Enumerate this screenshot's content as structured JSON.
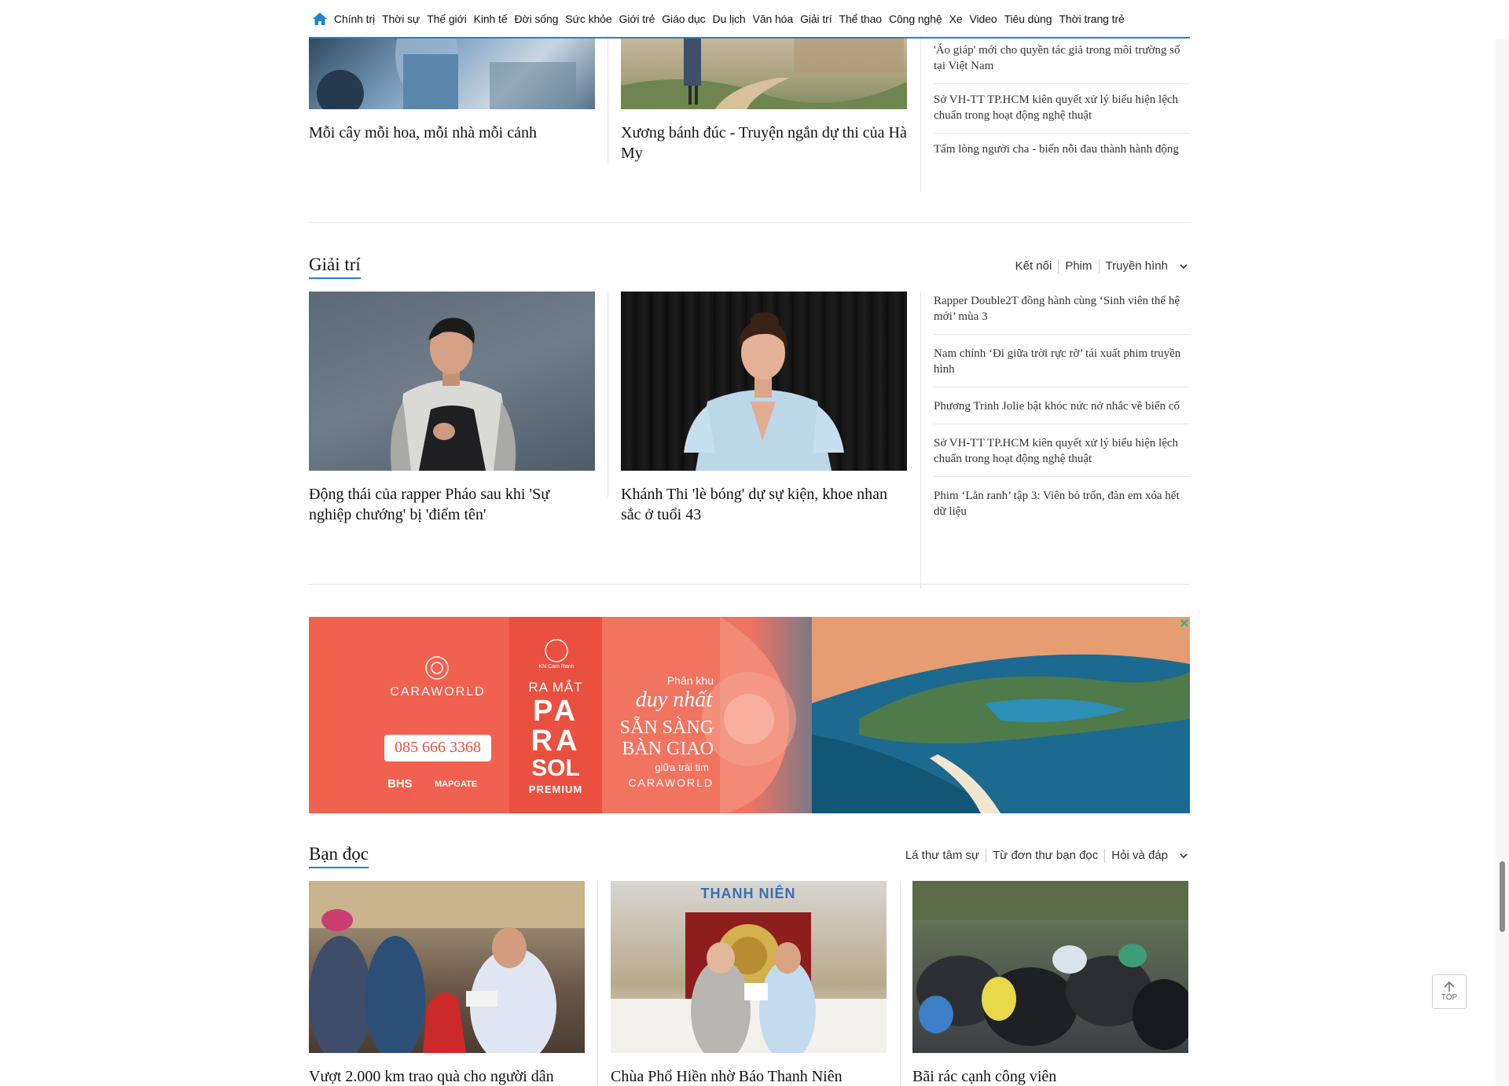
{
  "nav": {
    "items": [
      "Chính trị",
      "Thời sự",
      "Thế giới",
      "Kinh tế",
      "Đời sống",
      "Sức khỏe",
      "Giới trẻ",
      "Giáo dục",
      "Du lịch",
      "Văn hóa",
      "Giải trí",
      "Thể thao",
      "Công nghệ",
      "Xe",
      "Video",
      "Tiêu dùng",
      "Thời trang trẻ"
    ],
    "accent": "#1d86c9"
  },
  "section_vanhoa": {
    "cards": [
      {
        "title": "Mỗi cây mỗi hoa, mỗi nhà mỗi cảnh"
      },
      {
        "title": "Xương bánh đúc - Truyện ngắn dự thi của Hà My"
      }
    ],
    "side": [
      "'Áo giáp' mới cho quyền tác giả trong môi trường số tại Việt Nam",
      "Sở VH-TT TP.HCM kiên quyết xử lý biểu hiện lệch chuẩn trong hoạt động nghệ thuật",
      "Tấm lòng người cha - biến nỗi đau thành hành động"
    ]
  },
  "section_giaitri": {
    "title": "Giải trí",
    "tabs": [
      "Kết nối",
      "Phim",
      "Truyền hình"
    ],
    "cards": [
      {
        "title": "Động thái của rapper Pháo sau khi 'Sự nghiệp chướng' bị 'điểm tên'"
      },
      {
        "title": "Khánh Thi 'lè bóng' dự sự kiện, khoe nhan sắc ở tuổi 43"
      }
    ],
    "side": [
      "Rapper Double2T đồng hành cùng ‘Sinh viên thế hệ mới’ mùa 3",
      "Nam chính ‘Đi giữa trời rực rỡ’ tái xuất phim truyền hình",
      "Phương Trinh Jolie bật khóc nức nở nhắc về biến cố",
      "Sở VH-TT TP.HCM kiên quyết xử lý biểu hiện lệch chuẩn trong hoạt động nghệ thuật",
      "Phim ‘Lằn ranh’ tập 3: Viên bỏ trốn, đàn em xóa hết dữ liệu"
    ]
  },
  "banner": {
    "brand": "CARAWORLD",
    "badge": "KN Cam Ranh",
    "phone": "085 666 3368",
    "launch": "RA MẮT",
    "product_line1": "PA",
    "product_line2": "RA",
    "product_line3": "SOL",
    "product_tag": "PREMIUM",
    "tag1": "Phân khu",
    "tag2": "duy nhất",
    "tag3": "SẴN SÀNG",
    "tag4": "BÀN GIAO",
    "tag5": "giữa trái tim",
    "tag6": "CARAWORLD",
    "partner1": "BHS",
    "partner2": "MAPGATE"
  },
  "section_bandoc": {
    "title": "Bạn đọc",
    "tabs": [
      "Lá thư tâm sự",
      "Từ đơn thư bạn đọc",
      "Hỏi và đáp"
    ],
    "cards": [
      {
        "title": "Vượt 2.000 km trao quà cho người dân"
      },
      {
        "title": "Chùa Phổ Hiền nhờ Báo Thanh Niên"
      },
      {
        "title": "Bãi rác cạnh công viên"
      }
    ],
    "photo_sign": "THANH NIÊN"
  },
  "top_button": {
    "label": "TOP"
  }
}
